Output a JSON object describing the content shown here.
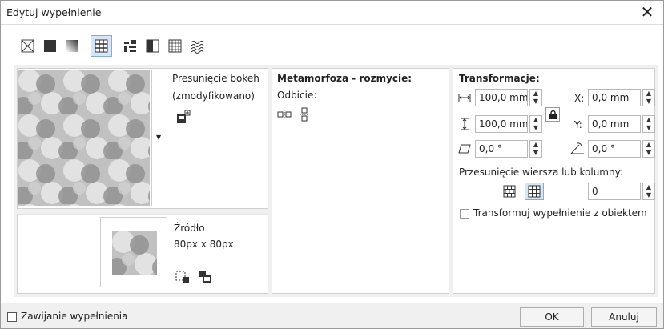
{
  "window": {
    "title": "Edytuj wypełnienie"
  },
  "fill_types": [
    {
      "name": "no-fill",
      "selected": false
    },
    {
      "name": "uniform-fill",
      "selected": false
    },
    {
      "name": "fountain-fill",
      "selected": false
    },
    {
      "name": "vector-pattern-fill",
      "selected": true
    },
    {
      "name": "bitmap-pattern-fill",
      "selected": false
    },
    {
      "name": "two-color-pattern-fill",
      "selected": false
    },
    {
      "name": "texture-fill",
      "selected": false
    },
    {
      "name": "postscript-fill",
      "selected": false
    }
  ],
  "pattern": {
    "name_line1": "Presunięcie bokeh",
    "name_line2": "(zmodyfikowano)"
  },
  "source": {
    "label": "Źródło",
    "size": "80px x 80px"
  },
  "mirror": {
    "title": "Metamorfoza - rozmycie:",
    "subtitle": "Odbicie:"
  },
  "transform": {
    "title": "Transformacje:",
    "width": "100,0 mm",
    "height": "100,0 mm",
    "x_label": "X:",
    "x_value": "0,0 mm",
    "y_label": "Y:",
    "y_value": "0,0 mm",
    "skew": "0,0 °",
    "rotate": "0,0 °",
    "offset_label": "Przesunięcie wiersza lub kolumny:",
    "offset_value": "0",
    "transform_with_object": "Transformuj wypełnienie z obiektem"
  },
  "footer": {
    "wrap_label": "Zawijanie wypełnienia",
    "ok": "OK",
    "cancel": "Anuluj"
  },
  "colors": {
    "accent": "#3c7fd4",
    "pattern_bg": "#b9b9b9",
    "pattern_light": "#dcdcdc",
    "pattern_dark": "#8c8c8c"
  }
}
